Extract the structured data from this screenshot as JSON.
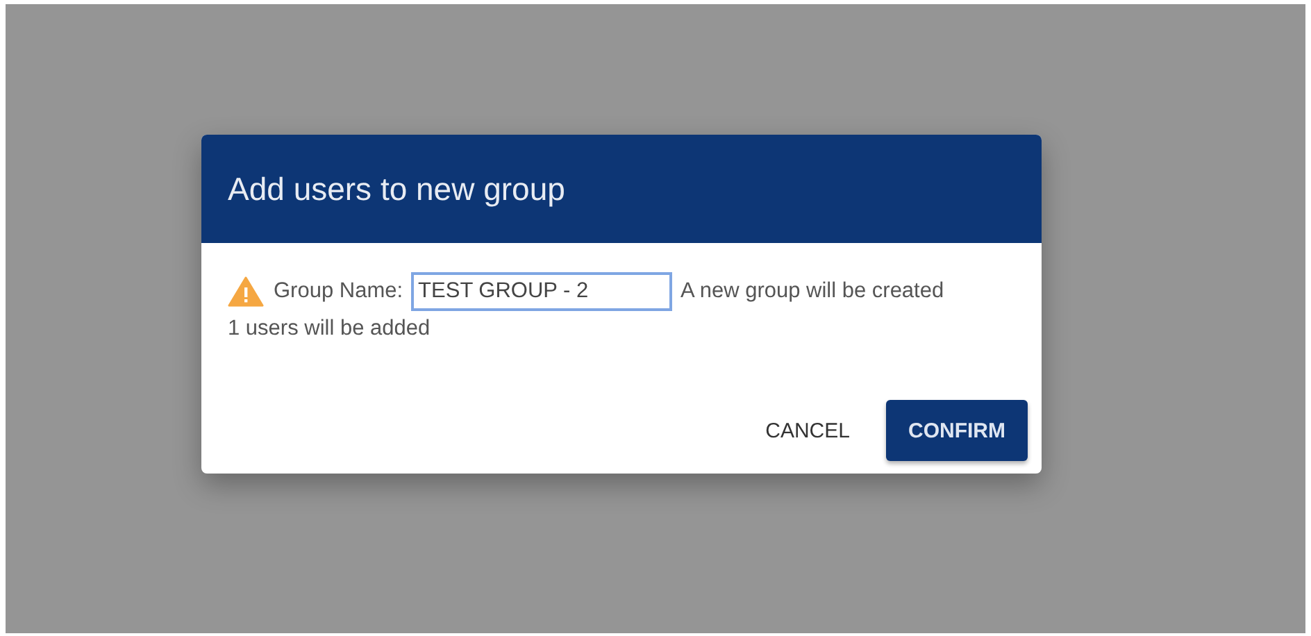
{
  "dialog": {
    "title": "Add users to new group",
    "field": {
      "label": "Group Name:",
      "value": "TEST GROUP - 2",
      "focused": true,
      "note": "A new group will be created"
    },
    "summary": "1 users will be added",
    "buttons": [
      {
        "label": "CANCEL",
        "kind": "text"
      },
      {
        "label": "CONFIRM",
        "kind": "primary"
      }
    ]
  }
}
